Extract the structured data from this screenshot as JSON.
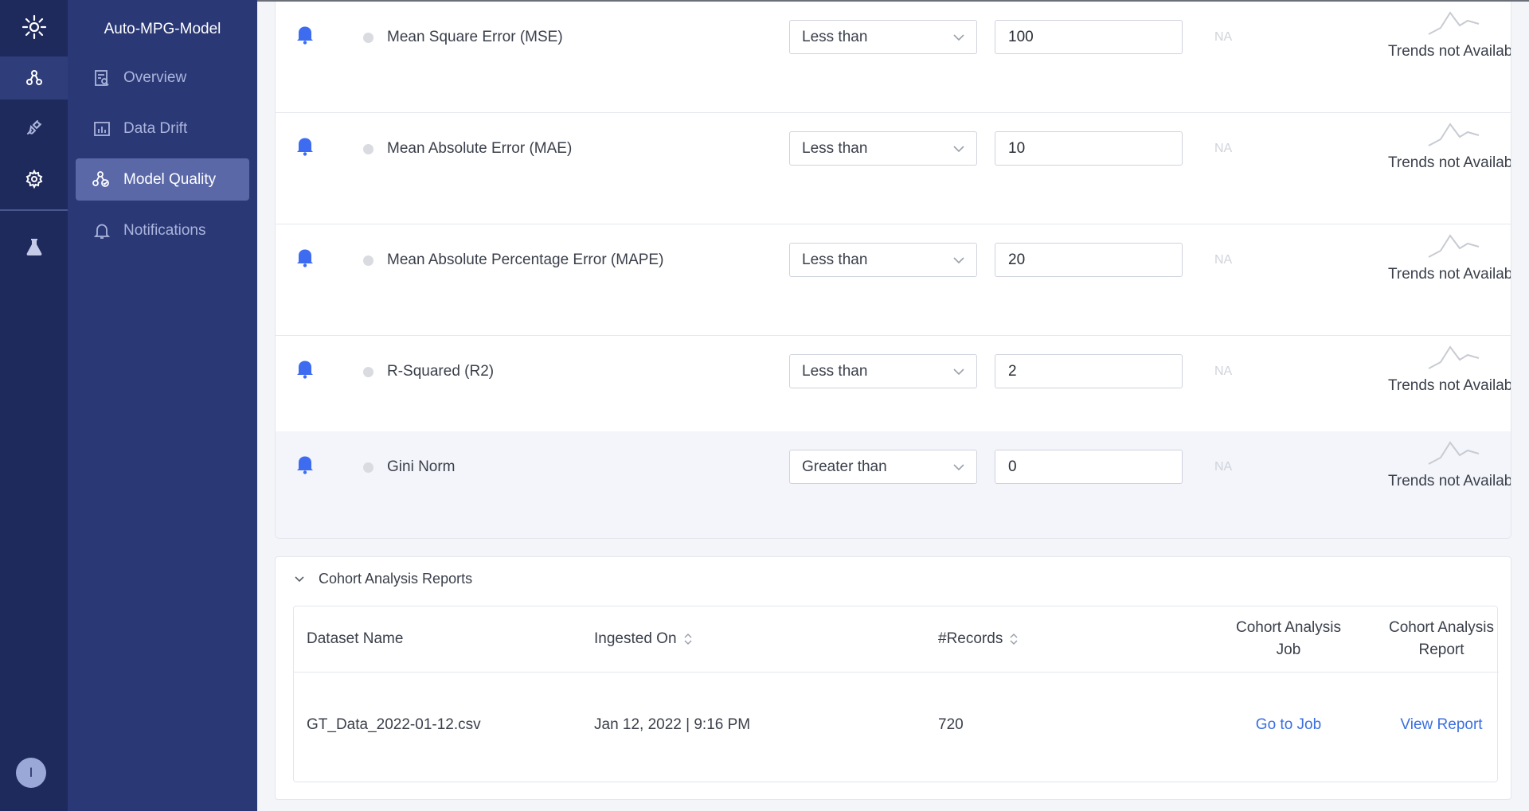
{
  "rail": {
    "icons": [
      "logo-icon",
      "models-icon",
      "integrations-icon",
      "settings-icon",
      "lab-icon"
    ],
    "avatar_initial": "I"
  },
  "sidebar": {
    "model_name": "Auto-MPG-Model",
    "items": [
      {
        "label": "Overview",
        "icon": "overview-icon",
        "active": false
      },
      {
        "label": "Data Drift",
        "icon": "data-drift-icon",
        "active": false
      },
      {
        "label": "Model Quality",
        "icon": "model-quality-icon",
        "active": true
      },
      {
        "label": "Notifications",
        "icon": "notifications-bell-icon",
        "active": false
      }
    ]
  },
  "rules": [
    {
      "metric": "Mean Square Error (MSE)",
      "condition": "Less than",
      "threshold": "100",
      "value": "NA",
      "trend": "Trends not Available"
    },
    {
      "metric": "Mean Absolute Error (MAE)",
      "condition": "Less than",
      "threshold": "10",
      "value": "NA",
      "trend": "Trends not Available"
    },
    {
      "metric": "Mean Absolute Percentage Error (MAPE)",
      "condition": "Less than",
      "threshold": "20",
      "value": "NA",
      "trend": "Trends not Available"
    },
    {
      "metric": "R-Squared (R2)",
      "condition": "Less than",
      "threshold": "2",
      "value": "NA",
      "trend": "Trends not Available"
    },
    {
      "metric": "Gini Norm",
      "condition": "Greater than",
      "threshold": "0",
      "value": "NA",
      "trend": "Trends not Available"
    }
  ],
  "cohort": {
    "title": "Cohort Analysis Reports",
    "columns": {
      "dataset": "Dataset Name",
      "ingested": "Ingested On",
      "records": "#Records",
      "job": "Cohort Analysis Job",
      "report": "Cohort Analysis Report"
    },
    "rows": [
      {
        "dataset": "GT_Data_2022-01-12.csv",
        "ingested": "Jan 12, 2022 | 9:16 PM",
        "records": "720",
        "job": "Go to Job",
        "report": "View Report"
      }
    ]
  },
  "colors": {
    "accent": "#3b6fe0",
    "rail": "#1f2a5c",
    "sidebar": "#2a3875",
    "bell": "#3d6cf0"
  }
}
